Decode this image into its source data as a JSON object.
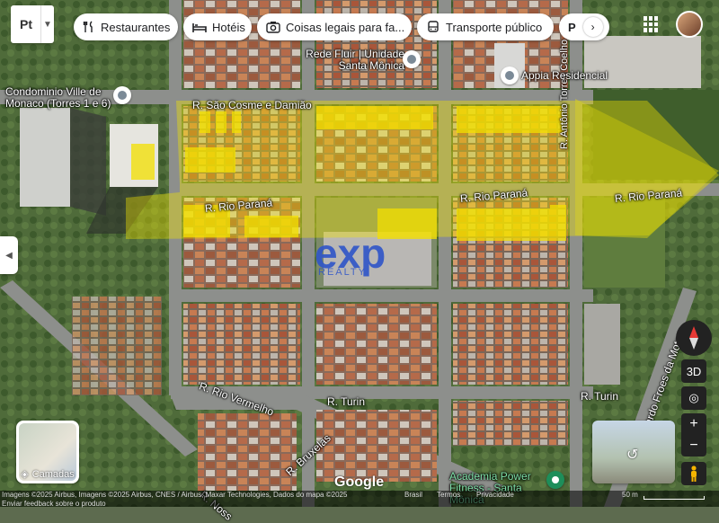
{
  "toolbar": {
    "language": "Pt",
    "chips": [
      {
        "label": "Restaurantes",
        "icon": "fork-knife-icon"
      },
      {
        "label": "Hotéis",
        "icon": "bed-icon"
      },
      {
        "label": "Coisas legais para fa...",
        "icon": "camera-icon"
      },
      {
        "label": "Transporte público",
        "icon": "bus-icon"
      },
      {
        "label": "P",
        "icon": "parking-icon"
      }
    ]
  },
  "streets": {
    "sao_cosme": "R. São Cosme e Damião",
    "parana_left": "R. Rio Paraná",
    "parana_mid": "R. Rio Paraná",
    "parana_right": "R. Rio Paraná",
    "vermelho": "R. Rio Vermelho",
    "turin1": "R. Turin",
    "turin2": "R. Turin",
    "eduardo": "R. Eduardo Froes da Mota",
    "bruxelas": "R. Bruxelas",
    "noss": "R. Noss",
    "top_vertical": "R. Antônio Torres Coelho"
  },
  "pois": {
    "condominio": "Condominio Ville de Monaco (Torres 1 e 6)",
    "rede_fluir": "Rede Fluir | Unidade Santa Mônica",
    "appia": "Appia Residencial",
    "academia": "Academia Power Fitness - Santa Mônica"
  },
  "watermark": {
    "brand": "exp",
    "sub": "REALTY"
  },
  "controls": {
    "three_d": "3D",
    "zoom_in": "+",
    "zoom_out": "−",
    "layers_label": "Camadas"
  },
  "footer": {
    "attribution": "Imagens ©2025 Airbus, Imagens ©2025 Airbus, CNES / Airbus, Maxar Technologies, Dados do mapa ©2025",
    "country": "Brasil",
    "terms": "Termos",
    "privacy": "Privacidade",
    "scale": "50 m",
    "feedback": "Enviar feedback sobre o produto",
    "google": "Google"
  },
  "colors": {
    "highlight": "#f2e600",
    "accent": "#1e8e5a"
  }
}
